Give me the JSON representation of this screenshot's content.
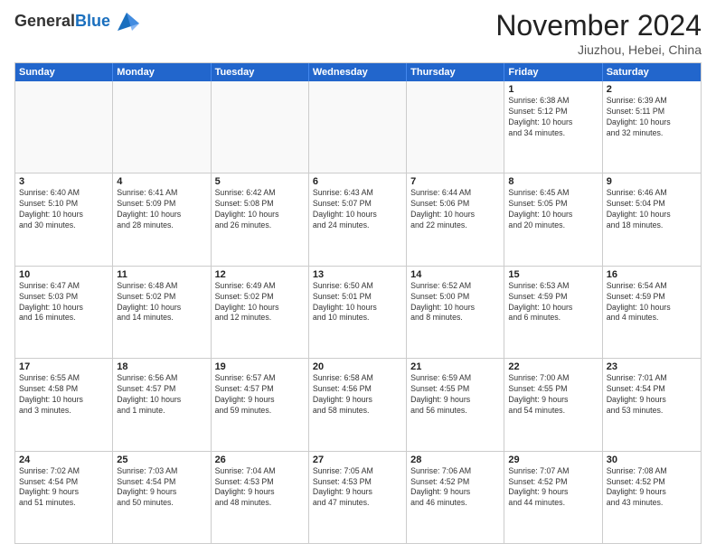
{
  "header": {
    "logo_general": "General",
    "logo_blue": "Blue",
    "month_title": "November 2024",
    "location": "Jiuzhou, Hebei, China"
  },
  "weekdays": [
    "Sunday",
    "Monday",
    "Tuesday",
    "Wednesday",
    "Thursday",
    "Friday",
    "Saturday"
  ],
  "rows": [
    [
      {
        "day": "",
        "info": "",
        "empty": true
      },
      {
        "day": "",
        "info": "",
        "empty": true
      },
      {
        "day": "",
        "info": "",
        "empty": true
      },
      {
        "day": "",
        "info": "",
        "empty": true
      },
      {
        "day": "",
        "info": "",
        "empty": true
      },
      {
        "day": "1",
        "info": "Sunrise: 6:38 AM\nSunset: 5:12 PM\nDaylight: 10 hours\nand 34 minutes.",
        "empty": false
      },
      {
        "day": "2",
        "info": "Sunrise: 6:39 AM\nSunset: 5:11 PM\nDaylight: 10 hours\nand 32 minutes.",
        "empty": false
      }
    ],
    [
      {
        "day": "3",
        "info": "Sunrise: 6:40 AM\nSunset: 5:10 PM\nDaylight: 10 hours\nand 30 minutes.",
        "empty": false
      },
      {
        "day": "4",
        "info": "Sunrise: 6:41 AM\nSunset: 5:09 PM\nDaylight: 10 hours\nand 28 minutes.",
        "empty": false
      },
      {
        "day": "5",
        "info": "Sunrise: 6:42 AM\nSunset: 5:08 PM\nDaylight: 10 hours\nand 26 minutes.",
        "empty": false
      },
      {
        "day": "6",
        "info": "Sunrise: 6:43 AM\nSunset: 5:07 PM\nDaylight: 10 hours\nand 24 minutes.",
        "empty": false
      },
      {
        "day": "7",
        "info": "Sunrise: 6:44 AM\nSunset: 5:06 PM\nDaylight: 10 hours\nand 22 minutes.",
        "empty": false
      },
      {
        "day": "8",
        "info": "Sunrise: 6:45 AM\nSunset: 5:05 PM\nDaylight: 10 hours\nand 20 minutes.",
        "empty": false
      },
      {
        "day": "9",
        "info": "Sunrise: 6:46 AM\nSunset: 5:04 PM\nDaylight: 10 hours\nand 18 minutes.",
        "empty": false
      }
    ],
    [
      {
        "day": "10",
        "info": "Sunrise: 6:47 AM\nSunset: 5:03 PM\nDaylight: 10 hours\nand 16 minutes.",
        "empty": false
      },
      {
        "day": "11",
        "info": "Sunrise: 6:48 AM\nSunset: 5:02 PM\nDaylight: 10 hours\nand 14 minutes.",
        "empty": false
      },
      {
        "day": "12",
        "info": "Sunrise: 6:49 AM\nSunset: 5:02 PM\nDaylight: 10 hours\nand 12 minutes.",
        "empty": false
      },
      {
        "day": "13",
        "info": "Sunrise: 6:50 AM\nSunset: 5:01 PM\nDaylight: 10 hours\nand 10 minutes.",
        "empty": false
      },
      {
        "day": "14",
        "info": "Sunrise: 6:52 AM\nSunset: 5:00 PM\nDaylight: 10 hours\nand 8 minutes.",
        "empty": false
      },
      {
        "day": "15",
        "info": "Sunrise: 6:53 AM\nSunset: 4:59 PM\nDaylight: 10 hours\nand 6 minutes.",
        "empty": false
      },
      {
        "day": "16",
        "info": "Sunrise: 6:54 AM\nSunset: 4:59 PM\nDaylight: 10 hours\nand 4 minutes.",
        "empty": false
      }
    ],
    [
      {
        "day": "17",
        "info": "Sunrise: 6:55 AM\nSunset: 4:58 PM\nDaylight: 10 hours\nand 3 minutes.",
        "empty": false
      },
      {
        "day": "18",
        "info": "Sunrise: 6:56 AM\nSunset: 4:57 PM\nDaylight: 10 hours\nand 1 minute.",
        "empty": false
      },
      {
        "day": "19",
        "info": "Sunrise: 6:57 AM\nSunset: 4:57 PM\nDaylight: 9 hours\nand 59 minutes.",
        "empty": false
      },
      {
        "day": "20",
        "info": "Sunrise: 6:58 AM\nSunset: 4:56 PM\nDaylight: 9 hours\nand 58 minutes.",
        "empty": false
      },
      {
        "day": "21",
        "info": "Sunrise: 6:59 AM\nSunset: 4:55 PM\nDaylight: 9 hours\nand 56 minutes.",
        "empty": false
      },
      {
        "day": "22",
        "info": "Sunrise: 7:00 AM\nSunset: 4:55 PM\nDaylight: 9 hours\nand 54 minutes.",
        "empty": false
      },
      {
        "day": "23",
        "info": "Sunrise: 7:01 AM\nSunset: 4:54 PM\nDaylight: 9 hours\nand 53 minutes.",
        "empty": false
      }
    ],
    [
      {
        "day": "24",
        "info": "Sunrise: 7:02 AM\nSunset: 4:54 PM\nDaylight: 9 hours\nand 51 minutes.",
        "empty": false
      },
      {
        "day": "25",
        "info": "Sunrise: 7:03 AM\nSunset: 4:54 PM\nDaylight: 9 hours\nand 50 minutes.",
        "empty": false
      },
      {
        "day": "26",
        "info": "Sunrise: 7:04 AM\nSunset: 4:53 PM\nDaylight: 9 hours\nand 48 minutes.",
        "empty": false
      },
      {
        "day": "27",
        "info": "Sunrise: 7:05 AM\nSunset: 4:53 PM\nDaylight: 9 hours\nand 47 minutes.",
        "empty": false
      },
      {
        "day": "28",
        "info": "Sunrise: 7:06 AM\nSunset: 4:52 PM\nDaylight: 9 hours\nand 46 minutes.",
        "empty": false
      },
      {
        "day": "29",
        "info": "Sunrise: 7:07 AM\nSunset: 4:52 PM\nDaylight: 9 hours\nand 44 minutes.",
        "empty": false
      },
      {
        "day": "30",
        "info": "Sunrise: 7:08 AM\nSunset: 4:52 PM\nDaylight: 9 hours\nand 43 minutes.",
        "empty": false
      }
    ]
  ]
}
